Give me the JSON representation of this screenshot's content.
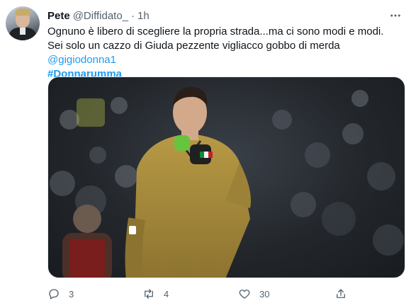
{
  "tweet": {
    "author": {
      "display_name": "Pete",
      "handle": "@Diffidato_",
      "separator": "·",
      "time": "1h"
    },
    "text": {
      "body": "Ognuno è libero di scegliere la propria strada...ma ci sono modi e modi. Sei solo un cazzo di Giuda pezzente vigliacco gobbo di merda ",
      "mention": "@gigiodonna1",
      "hashtag": "#Donnarumma"
    },
    "media": {
      "subject": "goalkeeper in gold kit celebrating in stadium"
    },
    "actions": {
      "reply_count": "3",
      "retweet_count": "4",
      "like_count": "30"
    }
  },
  "colors": {
    "link": "#1d9bf0",
    "secondary_text": "#536471",
    "primary_text": "#0f1419"
  },
  "icons": [
    "more-icon",
    "reply-icon",
    "retweet-icon",
    "like-icon",
    "share-icon"
  ]
}
